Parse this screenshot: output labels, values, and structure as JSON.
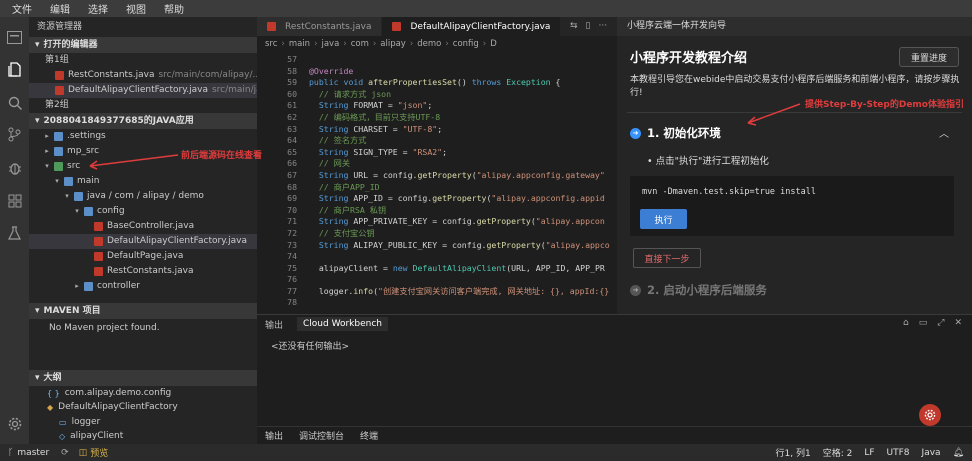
{
  "menu": [
    "文件",
    "编辑",
    "选择",
    "视图",
    "帮助"
  ],
  "explorer": {
    "title": "资源管理器",
    "open_editors_title": "打开的编辑器",
    "group1": "第1组",
    "group1_files": [
      {
        "name": "RestConstants.java",
        "path": "src/main/com/alipay/..."
      },
      {
        "name": "DefaultAlipayClientFactory.java",
        "path": "src/main/java..."
      }
    ],
    "group2": "第2组",
    "project_title": "2088041849377685的JAVA应用",
    "tree": [
      {
        "label": ".settings",
        "depth": 1,
        "kind": "folder",
        "twisty": "▸"
      },
      {
        "label": "mp_src",
        "depth": 1,
        "kind": "folder",
        "twisty": "▸"
      },
      {
        "label": "src",
        "depth": 1,
        "kind": "folder-green",
        "twisty": "▾"
      },
      {
        "label": "main",
        "depth": 2,
        "kind": "folder",
        "twisty": "▾"
      },
      {
        "label": "java / com / alipay / demo",
        "depth": 3,
        "kind": "folder",
        "twisty": "▾"
      },
      {
        "label": "config",
        "depth": 4,
        "kind": "folder",
        "twisty": "▾"
      },
      {
        "label": "BaseController.java",
        "depth": 5,
        "kind": "java",
        "twisty": ""
      },
      {
        "label": "DefaultAlipayClientFactory.java",
        "depth": 5,
        "kind": "java",
        "twisty": "",
        "selected": true
      },
      {
        "label": "DefaultPage.java",
        "depth": 5,
        "kind": "java",
        "twisty": ""
      },
      {
        "label": "RestConstants.java",
        "depth": 5,
        "kind": "java",
        "twisty": ""
      },
      {
        "label": "controller",
        "depth": 4,
        "kind": "folder",
        "twisty": "▸"
      }
    ],
    "maven_title": "MAVEN 项目",
    "maven_empty": "No Maven project found.",
    "outline_title": "大纲",
    "outline": [
      {
        "label": "com.alipay.demo.config",
        "depth": 1,
        "icon": "{ }"
      },
      {
        "label": "DefaultAlipayClientFactory",
        "depth": 1,
        "icon": "◆"
      },
      {
        "label": "logger",
        "depth": 2,
        "icon": "▭"
      },
      {
        "label": "alipayClient",
        "depth": 2,
        "icon": "◇"
      }
    ]
  },
  "editor": {
    "tabs": [
      {
        "label": "RestConstants.java",
        "active": false
      },
      {
        "label": "DefaultAlipayClientFactory.java",
        "active": true
      }
    ],
    "breadcrumbs": [
      "src",
      "main",
      "java",
      "com",
      "alipay",
      "demo",
      "config",
      "D"
    ],
    "lines": [
      {
        "n": "57",
        "t": ""
      },
      {
        "n": "58",
        "t": "@Override"
      },
      {
        "n": "59",
        "t": "public void afterPropertiesSet() throws Exception {"
      },
      {
        "n": "60",
        "t": "  // 请求方式 json"
      },
      {
        "n": "61",
        "t": "  String FORMAT = \"json\";"
      },
      {
        "n": "62",
        "t": "  // 编码格式，目前只支持UTF-8"
      },
      {
        "n": "63",
        "t": "  String CHARSET = \"UTF-8\";"
      },
      {
        "n": "64",
        "t": "  // 签名方式"
      },
      {
        "n": "65",
        "t": "  String SIGN_TYPE = \"RSA2\";"
      },
      {
        "n": "66",
        "t": "  // 网关"
      },
      {
        "n": "67",
        "t": "  String URL = config.getProperty(\"alipay.appconfig.gateway\""
      },
      {
        "n": "68",
        "t": "  // 商户APP_ID"
      },
      {
        "n": "69",
        "t": "  String APP_ID = config.getProperty(\"alipay.appconfig.appid"
      },
      {
        "n": "70",
        "t": "  // 商户RSA 私钥"
      },
      {
        "n": "71",
        "t": "  String APP_PRIVATE_KEY = config.getProperty(\"alipay.appcon"
      },
      {
        "n": "72",
        "t": "  // 支付宝公钥"
      },
      {
        "n": "73",
        "t": "  String ALIPAY_PUBLIC_KEY = config.getProperty(\"alipay.appco"
      },
      {
        "n": "74",
        "t": ""
      },
      {
        "n": "75",
        "t": "  alipayClient = new DefaultAlipayClient(URL, APP_ID, APP_PR"
      },
      {
        "n": "76",
        "t": ""
      },
      {
        "n": "77",
        "t": "  logger.info(\"创建支付宝网关访问客户端完成, 网关地址: {}, appId:{}"
      },
      {
        "n": "78",
        "t": ""
      }
    ]
  },
  "output": {
    "tab1": "输出",
    "tab2": "Cloud Workbench",
    "empty": "<还没有任何输出>",
    "bottom_tabs": [
      "输出",
      "调试控制台",
      "终端"
    ]
  },
  "panel": {
    "title": "小程序云端一体开发向导",
    "heading": "小程序开发教程介绍",
    "reset": "重置进度",
    "desc": "本教程引导您在webide中启动交易支付小程序后端服务和前端小程序，请按步骤执行!",
    "step1": "1. 初始化环境",
    "bullet": "点击\"执行\"进行工程初始化",
    "command": "mvn -Dmaven.test.skip=true install",
    "run": "执行",
    "next": "直接下一步",
    "step2": "2. 启动小程序后端服务"
  },
  "annotations": {
    "a1": "提供Step-By-Step的Demo体验指引",
    "a2": "前后端源码在线查看"
  },
  "status": {
    "branch": "master",
    "preview": "预览",
    "position": "行1, 列1",
    "spaces": "空格: 2",
    "eol": "LF",
    "encoding": "UTF8",
    "lang": "Java"
  },
  "colors": {
    "accent": "#3b7ed4",
    "annotation": "#e03c3c",
    "java": "#c0392b"
  }
}
